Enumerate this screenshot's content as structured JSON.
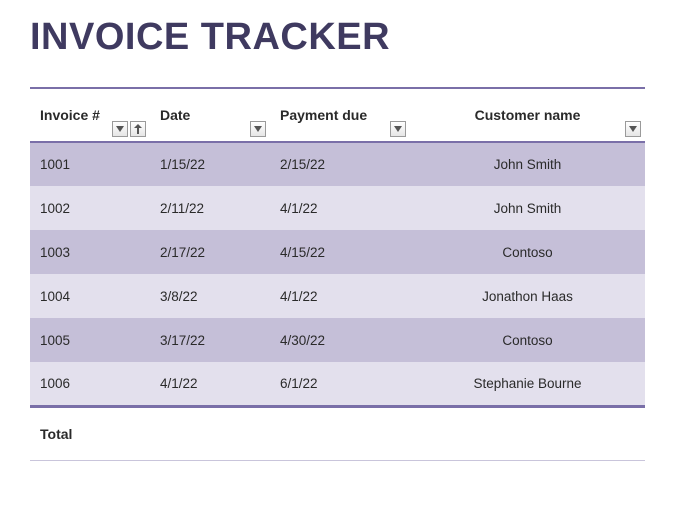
{
  "title": "INVOICE TRACKER",
  "columns": {
    "invoice": "Invoice #",
    "date": "Date",
    "due": "Payment due",
    "customer": "Customer name"
  },
  "rows": [
    {
      "invoice": "1001",
      "date": "1/15/22",
      "due": "2/15/22",
      "customer": "John Smith"
    },
    {
      "invoice": "1002",
      "date": "2/11/22",
      "due": "4/1/22",
      "customer": "John Smith"
    },
    {
      "invoice": "1003",
      "date": "2/17/22",
      "due": "4/15/22",
      "customer": "Contoso"
    },
    {
      "invoice": "1004",
      "date": "3/8/22",
      "due": "4/1/22",
      "customer": "Jonathon Haas"
    },
    {
      "invoice": "1005",
      "date": "3/17/22",
      "due": "4/30/22",
      "customer": "Contoso"
    },
    {
      "invoice": "1006",
      "date": "4/1/22",
      "due": "6/1/22",
      "customer": "Stephanie Bourne"
    }
  ],
  "footer": {
    "label": "Total"
  }
}
